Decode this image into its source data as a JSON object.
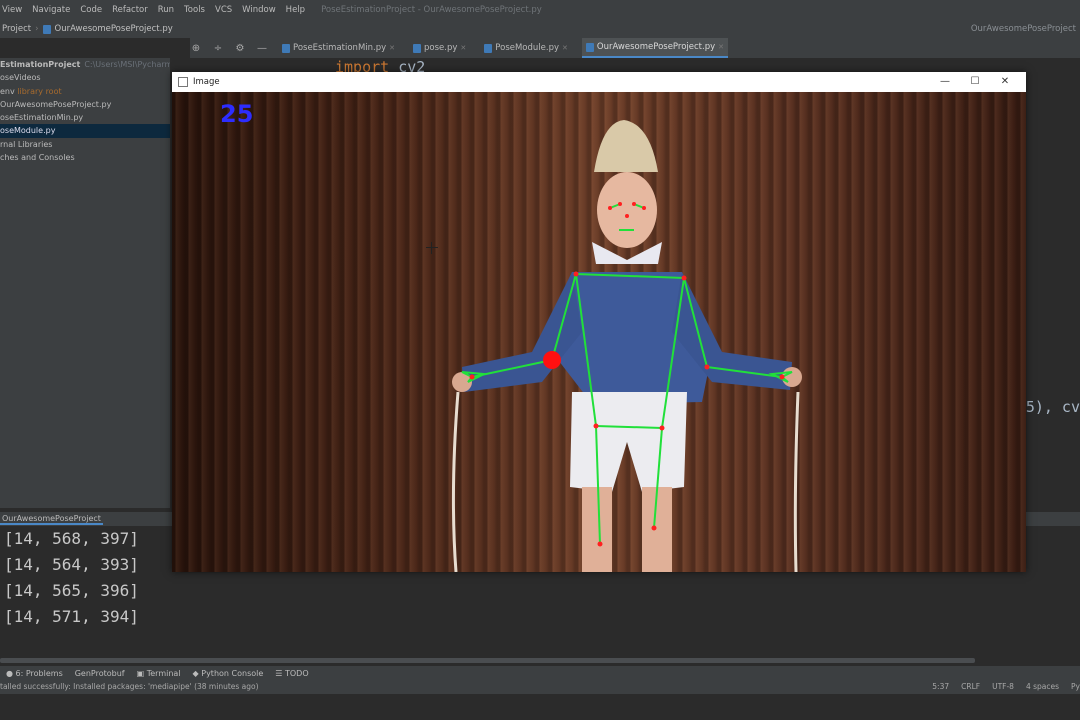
{
  "menu": {
    "items": [
      "View",
      "Navigate",
      "Code",
      "Refactor",
      "Run",
      "Tools",
      "VCS",
      "Window",
      "Help"
    ],
    "window_title": "PoseEstimationProject - OurAwesomePoseProject.py"
  },
  "navbar": {
    "project_label": "Project",
    "current_file": "OurAwesomePoseProject.py",
    "run_config": "OurAwesomePoseProject"
  },
  "tabs": [
    {
      "label": "PoseEstimationMin.py",
      "active": false
    },
    {
      "label": "pose.py",
      "active": false
    },
    {
      "label": "PoseModule.py",
      "active": false
    },
    {
      "label": "OurAwesomePoseProject.py",
      "active": true
    }
  ],
  "project_tree": {
    "root": "EstimationProject",
    "root_path": "C:\\Users\\MSI\\PycharmProjects\\PoseEstimationProject",
    "items": [
      {
        "label": "oseVideos",
        "selected": false,
        "note": ""
      },
      {
        "label": "env",
        "selected": false,
        "note": "library root"
      },
      {
        "label": "OurAwesomePoseProject.py",
        "selected": false,
        "note": ""
      },
      {
        "label": "oseEstimationMin.py",
        "selected": false,
        "note": ""
      },
      {
        "label": "oseModule.py",
        "selected": true,
        "note": ""
      },
      {
        "label": "rnal Libraries",
        "selected": false,
        "note": ""
      },
      {
        "label": "ches and Consoles",
        "selected": false,
        "note": ""
      }
    ]
  },
  "editor": {
    "code_line_keyword": "import",
    "code_line_module": "cv2",
    "code_right_fragment": "5), cv"
  },
  "image_window": {
    "title": "Image",
    "fps_text": "25",
    "controls": {
      "minimize": "—",
      "maximize": "☐",
      "close": "✕"
    }
  },
  "run_panel": {
    "label": "OurAwesomePoseProject",
    "lines": [
      "[14, 568, 397]",
      "[14, 564, 393]",
      "[14, 565, 396]",
      "[14, 571, 394]"
    ]
  },
  "toolwindows": [
    {
      "icon": "problems-icon",
      "label": "6: Problems"
    },
    {
      "icon": "protobuf-icon",
      "label": "GenProtobuf"
    },
    {
      "icon": "terminal-icon",
      "label": "Terminal"
    },
    {
      "icon": "python-icon",
      "label": "Python Console"
    },
    {
      "icon": "todo-icon",
      "label": "TODO"
    }
  ],
  "status": {
    "message": "talled successfully: Installed packages: 'mediapipe' (38 minutes ago)",
    "position": "5:37",
    "line_sep": "CRLF",
    "encoding": "UTF-8",
    "indent": "4 spaces",
    "interpreter": "Py"
  }
}
